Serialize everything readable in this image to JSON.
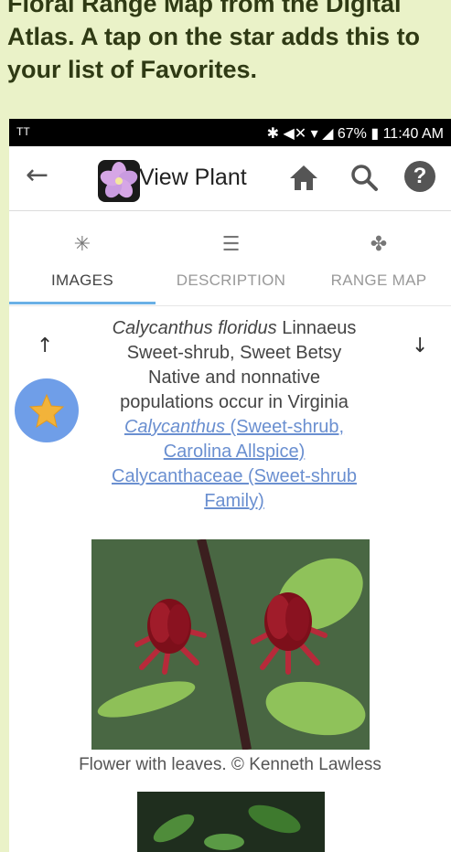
{
  "caption": {
    "line1": "Floral Range Map from the Digital",
    "line2": "Atlas. A tap on the star adds this to",
    "line3": "your list of Favorites."
  },
  "statusbar": {
    "left": "TT",
    "right": "✱ ◀✕ ▾ ◢ 67% ▮ 11:40 AM",
    "battery": "67%",
    "time": "11:40 AM"
  },
  "appbar": {
    "title": "View Plant"
  },
  "tabs": [
    {
      "label": "IMAGES",
      "icon": "sparkle-icon"
    },
    {
      "label": "DESCRIPTION",
      "icon": "list-icon"
    },
    {
      "label": "RANGE MAP",
      "icon": "puzzle-icon"
    }
  ],
  "plant": {
    "scientific_name": "Calycanthus floridus",
    "author": "Linnaeus",
    "common_names": "Sweet-shrub, Sweet Betsy",
    "status_line1": "Native and nonnative",
    "status_line2": "populations occur in Virginia",
    "genus_link_italic": "Calycanthus",
    "genus_link_rest": " (Sweet-shrub,",
    "genus_link_line2": "Carolina Allspice)",
    "family_link_line1": "Calycanthaceae (Sweet-shrub",
    "family_link_line2": "Family)"
  },
  "photo": {
    "caption": "Flower with leaves. © Kenneth Lawless"
  },
  "colors": {
    "page_bg": "#eaf2c8",
    "accent": "#6ab0e6",
    "link": "#6a8fd0",
    "star_button": "#6f9ee8",
    "star": "#f2b33a"
  }
}
